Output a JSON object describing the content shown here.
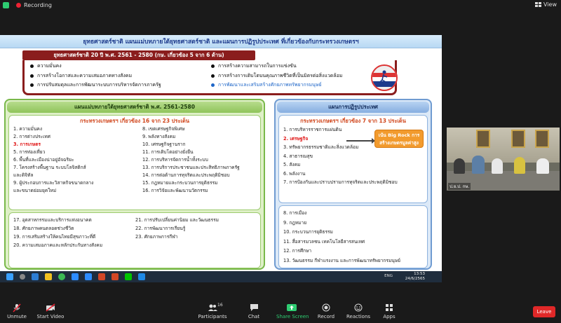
{
  "topbar": {
    "recording_label": "Recording",
    "view_label": "View"
  },
  "slide": {
    "header": "ยุทธศาสตร์ชาติ แผนแม่บทภายใต้ยุทธศาสตร์ชาติ และแผนการปฏิรูปประเทศ ที่เกี่ยวข้องกับกระทรวงเกษตรฯ",
    "strategy_title": "ยุทธศาสตร์ชาติ 20 ปี พ.ศ. 2561 - 2580 (กษ. เกี่ยวข้อง 5 จาก 6 ด้าน)",
    "strategy_left": [
      "ความมั่นคง",
      "การสร้างโอกาสและความเสมอภาคทางสังคม",
      "การปรับสมดุลและการพัฒนาระบบการบริหารจัดการภาครัฐ"
    ],
    "strategy_right": [
      "การสร้างความสามารถในการแข่งขัน",
      "การสร้างการเติบโตบนคุณภาพชีวิตที่เป็นมิตรต่อสิ่งแวดล้อม",
      "การพัฒนาและเสริมสร้างศักยภาพทรัพยากรมนุษย์"
    ],
    "logo_text": "ยุทธศาสตร์ชาติ",
    "left_panel": {
      "title": "แผนแม่บทภายใต้ยุทธศาสตร์ชาติ พ.ศ. 2561-2580",
      "subtitle": "กระทรวงเกษตรฯ เกี่ยวข้อง 16 จาก 23 ประเด็น",
      "col1": [
        "1. ความมั่นคง",
        "2. การต่างประเทศ",
        "3. การเกษตร",
        "5. การท่องเที่ยว",
        "6. พื้นที่และเมืองน่าอยู่อัจฉริยะ",
        "7. โครงสร้างพื้นฐาน ระบบโลจิสติกส์",
        "   และดิจิทัล",
        "9. ผู้ประกอบการและวิสาหกิจขนาดกลาง",
        "   และขนาดย่อมยุคใหม่"
      ],
      "col2": [
        "8. เขตเศรษฐกิจพิเศษ",
        "9. พลังทางสังคม",
        "10. เศรษฐกิจฐานราก",
        "11. การเติบโตอย่างยั่งยืน",
        "12. การบริหารจัดการน้ำทั้งระบบ",
        "13. การบริการประชาชนและประสิทธิภาพภาครัฐ",
        "14. การต่อต้านการทุจริตและประพฤติมิชอบ",
        "15. กฎหมายและกระบวนการยุติธรรม",
        "16. การวิจัยและพัฒนานวัตกรรม"
      ],
      "bottom_col1": [
        "17. อุตสาหกรรมและบริการแห่งอนาคต",
        "18. ศักยภาพคนตลอดช่วงชีวิต",
        "19. การเสริมสร้างให้คนไทยมีสุขภาวะที่ดี",
        "20. ความเสมอภาคและหลักประกันทางสังคม"
      ],
      "bottom_col2": [
        "21. การปรับเปลี่ยนค่านิยม และวัฒนธรรม",
        "22. การพัฒนาการเรียนรู้",
        "23. ศักยภาพการกีฬา"
      ]
    },
    "right_panel": {
      "title": "แผนการปฏิรูปประเทศ",
      "subtitle": "กระทรวงเกษตรฯ เกี่ยวข้อง 7 จาก 13 ประเด็น",
      "items": [
        "1. การบริหารราชการแผ่นดิน",
        "2. เศรษฐกิจ",
        "3. ทรัพยากรธรรมชาติและสิ่งแวดล้อม",
        "4. สาธารณสุข",
        "5. สังคม",
        "6. พลังงาน",
        "7. การป้องกันและปราบปรามการทุจริตและประพฤติมิชอบ"
      ],
      "note": "เน้น Big Rock การสร้างเกษตรมูลค่าสูง",
      "bottom_items": [
        "8. การเมือง",
        "9. กฎหมาย",
        "10. กระบวนการยุติธรรม",
        "11. สื่อสารมวลชน เทคโนโลยีสารสนเทศ",
        "12. การศึกษา",
        "13. วัฒนธรรม กีฬาแรงงาน และการพัฒนาทรัพยากรมนุษย์"
      ]
    }
  },
  "taskbar": {
    "tray_lang": "ENG",
    "time": "13:53",
    "date": "24/6/2565"
  },
  "video": {
    "participant_label": "ป.ย.ป. กษ."
  },
  "controls": {
    "unmute": "Unmute",
    "start_video": "Start Video",
    "participants": "Participants",
    "participants_count": "16",
    "chat": "Chat",
    "share_screen": "Share Screen",
    "record": "Record",
    "reactions": "Reactions",
    "apps": "Apps",
    "leave": "Leave"
  },
  "colors": {
    "accent_red": "#8a1d1d",
    "green_panel": "#79b84a",
    "blue_panel": "#6f9bd1",
    "highlight_orange": "#f29b2e",
    "leave_red": "#e02828"
  }
}
